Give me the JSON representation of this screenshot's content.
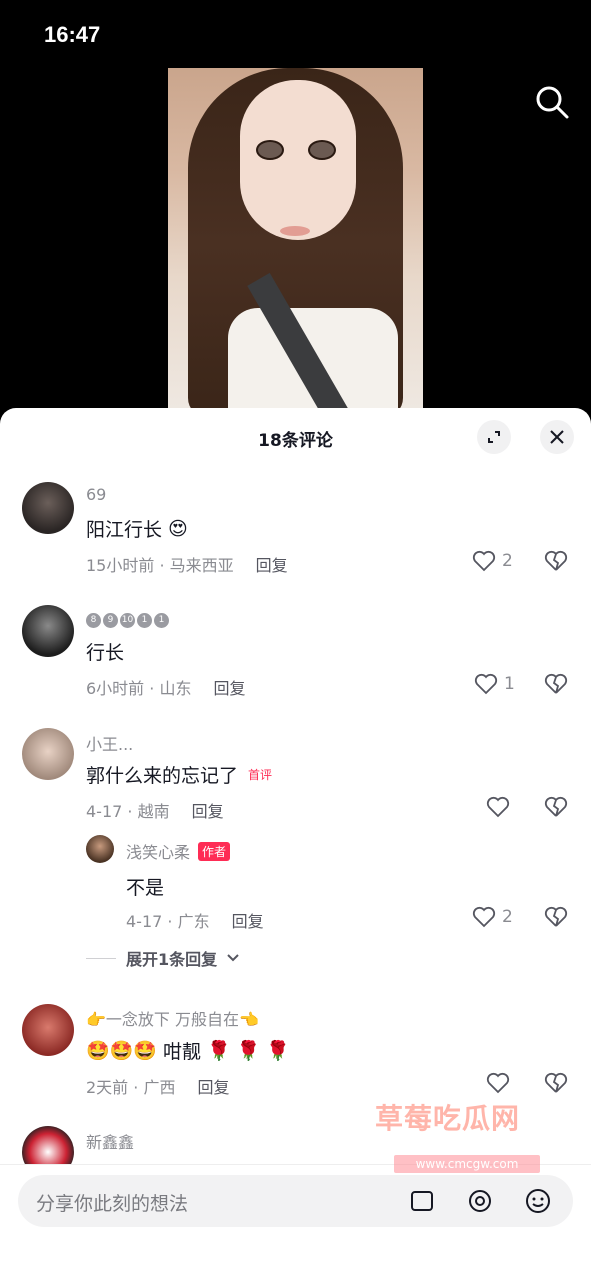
{
  "status_bar": {
    "time": "16:47"
  },
  "video": {
    "description": ""
  },
  "comments_panel": {
    "title": "18条评论",
    "comments": [
      {
        "username": "69",
        "text": "阳江行长",
        "emoji": "😍",
        "time_location": "15小时前 · 马来西亚",
        "reply": "回复",
        "likes": "2"
      },
      {
        "username_badges": [
          "8",
          "9",
          "10",
          "1",
          "1"
        ],
        "text": "行长",
        "time_location": "6小时前 · 山东",
        "reply": "回复",
        "likes": "1"
      },
      {
        "username": "小王...",
        "text": "郭什么来的忘记了",
        "tag": "首评",
        "time_location": "4-17 · 越南",
        "reply": "回复",
        "likes": ""
      },
      {
        "username": "浅笑心柔",
        "tag": "作者",
        "text": "不是",
        "time_location": "4-17 · 广东",
        "reply": "回复",
        "likes": "2"
      },
      {
        "username": "👉一念放下 万般自在👈",
        "text_prefix": "🤩🤩🤩",
        "text": "咁靓",
        "text_suffix": "🌹 🌹 🌹",
        "time_location": "2天前 · 广西",
        "reply": "回复",
        "likes": ""
      },
      {
        "username": "新鑫鑫"
      }
    ],
    "expand_replies": "展开1条回复",
    "input_placeholder": "分享你此刻的想法"
  },
  "watermark": {
    "text": "草莓吃瓜网",
    "url": "www.cmcgw.com"
  }
}
